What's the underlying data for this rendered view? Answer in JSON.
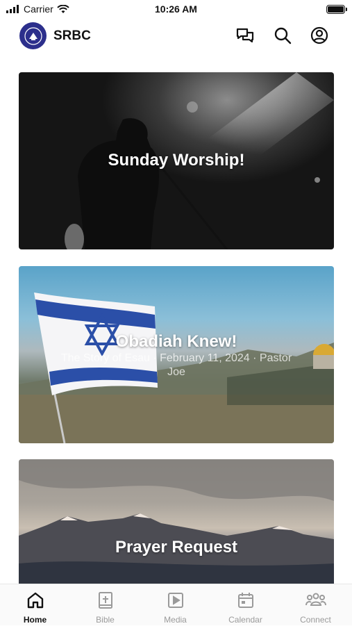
{
  "status": {
    "carrier": "Carrier",
    "time": "10:26 AM"
  },
  "header": {
    "brand": "SRBC"
  },
  "cards": [
    {
      "title": "Sunday Worship!",
      "subtitle": ""
    },
    {
      "title": "Obadiah Knew!",
      "subtitle": "The Story of Esau · February 11, 2024 · Pastor Joe"
    },
    {
      "title": "Prayer Request",
      "subtitle": ""
    }
  ],
  "tabs": [
    {
      "label": "Home",
      "icon": "home-icon",
      "active": true
    },
    {
      "label": "Bible",
      "icon": "bible-icon"
    },
    {
      "label": "Media",
      "icon": "media-icon"
    },
    {
      "label": "Calendar",
      "icon": "calendar-icon"
    },
    {
      "label": "Connect",
      "icon": "connect-icon"
    }
  ]
}
